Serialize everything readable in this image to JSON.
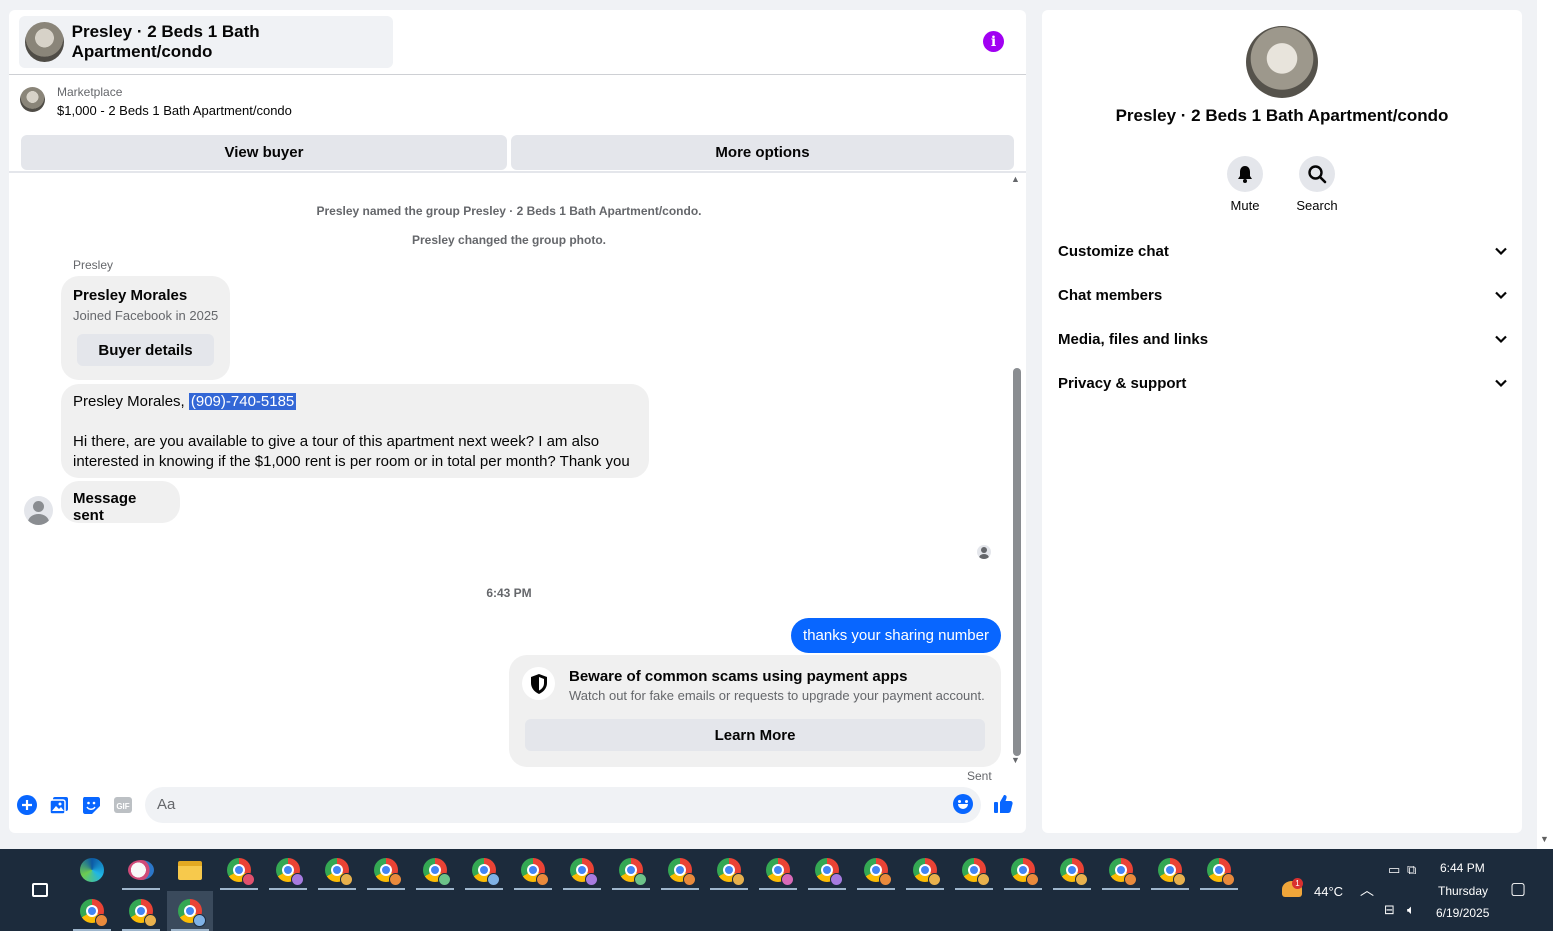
{
  "chat": {
    "title": "Presley · 2 Beds 1 Bath Apartment/condo",
    "marketplace": {
      "kicker": "Marketplace",
      "listing": "$1,000 - 2 Beds 1 Bath Apartment/condo",
      "view_buyer": "View buyer",
      "more_options": "More options"
    },
    "system_messages": [
      "Presley named the group Presley · 2 Beds 1 Bath Apartment/condo.",
      "Presley changed the group photo."
    ],
    "sender_name": "Presley",
    "profile_card": {
      "name": "Presley Morales",
      "joined": "Joined Facebook in 2025",
      "button": "Buyer details"
    },
    "incoming_message": {
      "prefix": "Presley Morales, ",
      "phone": "(909)-740-5185",
      "line1": "Hi there, are you available to give a tour of this apartment next week? I am also",
      "line2": "interested in knowing if the $1,000 rent is per room or in total per month? Thank you"
    },
    "message_sent_badge": "Message sent",
    "time_separator": "6:43 PM",
    "outgoing_message": "thanks your sharing number",
    "scam_warning": {
      "title": "Beware of common scams using payment apps",
      "body": "Watch out for fake emails or requests to upgrade your payment account.",
      "button": "Learn More"
    },
    "sent_status": "Sent",
    "composer": {
      "placeholder": "Aa",
      "gif_label": "GIF"
    }
  },
  "sidebar": {
    "title": "Presley · 2 Beds 1 Bath Apartment/condo",
    "actions": [
      {
        "label": "Mute",
        "icon": "bell-icon"
      },
      {
        "label": "Search",
        "icon": "search-icon"
      }
    ],
    "sections": [
      {
        "label": "Customize chat"
      },
      {
        "label": "Chat members"
      },
      {
        "label": "Media, files and links"
      },
      {
        "label": "Privacy & support"
      }
    ]
  },
  "taskbar": {
    "weather_badge": "1",
    "temperature": "44°C",
    "time": "6:44 PM",
    "day": "Thursday",
    "date": "6/19/2025"
  },
  "colors": {
    "accent": "#0866ff",
    "info": "#a100f2",
    "taskbar": "#1c2b3c"
  }
}
